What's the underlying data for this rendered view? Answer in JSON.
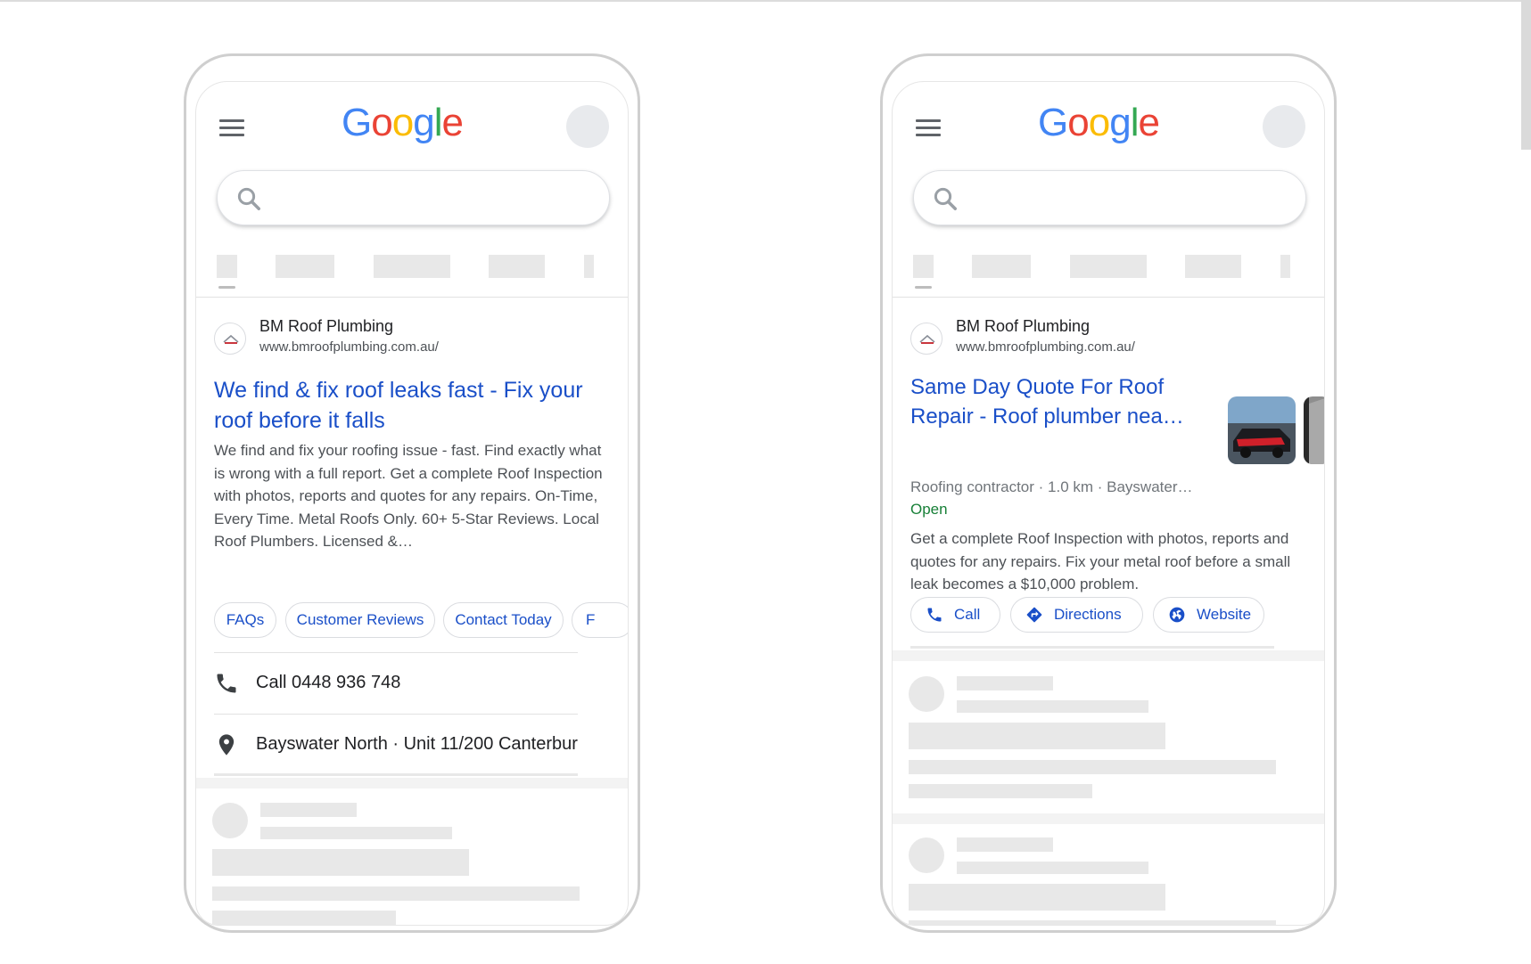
{
  "left_phone": {
    "logo": [
      "G",
      "o",
      "o",
      "g",
      "l",
      "e"
    ],
    "advertiser": {
      "name": "BM Roof Plumbing",
      "url": "www.bmroofplumbing.com.au/"
    },
    "ad_title": "We find & fix roof leaks fast - Fix your roof before it falls",
    "ad_description": "We find and fix your roofing issue - fast. Find exactly what is wrong with a full report. Get a complete Roof Inspection with photos, reports and quotes for any repairs. On-Time, Every Time. Metal Roofs Only. 60+ 5-Star Reviews. Local Roof Plumbers. Licensed &…",
    "sitelinks": [
      "FAQs",
      "Customer Reviews",
      "Contact Today",
      "F"
    ],
    "call_extension": "Call 0448 936 748",
    "location_extension": "Bayswater North · Unit 11/200 Canterbur…"
  },
  "right_phone": {
    "logo": [
      "G",
      "o",
      "o",
      "g",
      "l",
      "e"
    ],
    "advertiser": {
      "name": "BM Roof Plumbing",
      "url": "www.bmroofplumbing.com.au/"
    },
    "ad_title": "Same Day Quote For Roof Repair - Roof plumber nea…",
    "business_meta": "Roofing contractor · 1.0 km · Bayswater…",
    "open_status": "Open",
    "ad_description": "Get a complete Roof Inspection with photos, reports and quotes for any repairs. Fix your metal roof before a small leak becomes a $10,000 problem.",
    "actions": [
      {
        "label": "Call",
        "icon": "phone-icon"
      },
      {
        "label": "Directions",
        "icon": "directions-icon"
      },
      {
        "label": "Website",
        "icon": "globe-icon"
      }
    ]
  },
  "colors": {
    "link_blue": "#1a4fc8",
    "open_green": "#188038",
    "google_blue": "#4285F4",
    "google_red": "#EA4335",
    "google_yellow": "#FBBC05",
    "google_green": "#34A853",
    "placeholder_gray": "#e8e8e8"
  }
}
